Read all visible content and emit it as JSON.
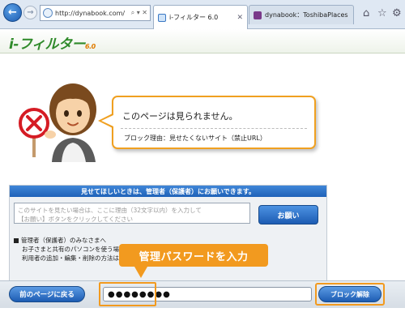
{
  "browser": {
    "address": "http://dynabook.com/",
    "address_controls": "⌕ ▾ ✕",
    "tabs": [
      {
        "label": "i-フィルター 6.0",
        "active": true
      },
      {
        "label": "dynabook：ToshibaPlaces",
        "active": false
      }
    ],
    "icons": [
      "back-arrow-icon",
      "forward-arrow-icon",
      "home-icon",
      "star-icon",
      "gear-icon"
    ]
  },
  "header": {
    "logo_text": "i-フィルター",
    "logo_version": "6.0"
  },
  "block_message": {
    "title": "このページは見られません。",
    "reason": "ブロック理由：見せたくないサイト（禁止URL）"
  },
  "request_panel": {
    "header": "見せてほしいときは、管理者（保護者）にお願いできます。",
    "reason_placeholder_line1": "このサイトを見たい場合は、ここに理由（32文字以内）を入力して",
    "reason_placeholder_line2": "【お願い】ボタンをクリックしてください",
    "request_button": "お願い",
    "admin_note_line1": "管理者（保護者）のみなさまへ",
    "admin_note_line2": "お子さまと共有のパソコンを使う場合、",
    "admin_note_line3": "利用者の追加・編集・削除の方法は、こ"
  },
  "callout": {
    "text": "管理パスワードを入力"
  },
  "bottom_bar": {
    "back_button": "前のページに戻る",
    "password_value": "●●●●●●●●",
    "unblock_button": "ブロック解除"
  },
  "colors": {
    "accent_orange": "#f29a1f",
    "button_blue": "#1d5cb3",
    "logo_green": "#2f8a2a"
  }
}
